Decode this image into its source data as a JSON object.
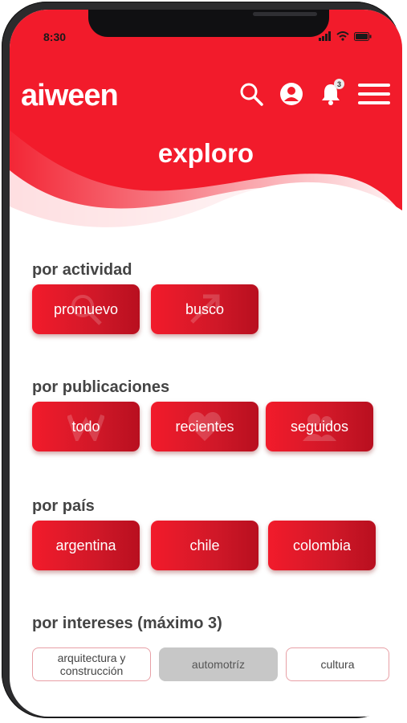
{
  "status": {
    "time": "8:30"
  },
  "header": {
    "logo": "aiween",
    "notification_count": "3",
    "title": "exploro",
    "icons": [
      "search-icon",
      "user-icon",
      "bell-icon",
      "menu-icon"
    ]
  },
  "colors": {
    "brand_red": "#f21b2b",
    "dark_red": "#b80f1f",
    "chip_selected": "#c7c7c7"
  },
  "sections": {
    "actividad": {
      "label": "por actividad",
      "buttons": [
        "promuevo",
        "busco"
      ]
    },
    "publicaciones": {
      "label": "por publicaciones",
      "buttons": [
        "todo",
        "recientes",
        "seguidos"
      ]
    },
    "pais": {
      "label": "por país",
      "buttons": [
        "argentina",
        "chile",
        "colombia"
      ]
    },
    "intereses": {
      "label": "por intereses (máximo 3)",
      "chips": [
        {
          "label": "arquitectura y construcción",
          "selected": false
        },
        {
          "label": "automotríz",
          "selected": true
        },
        {
          "label": "cultura",
          "selected": false
        }
      ]
    }
  }
}
